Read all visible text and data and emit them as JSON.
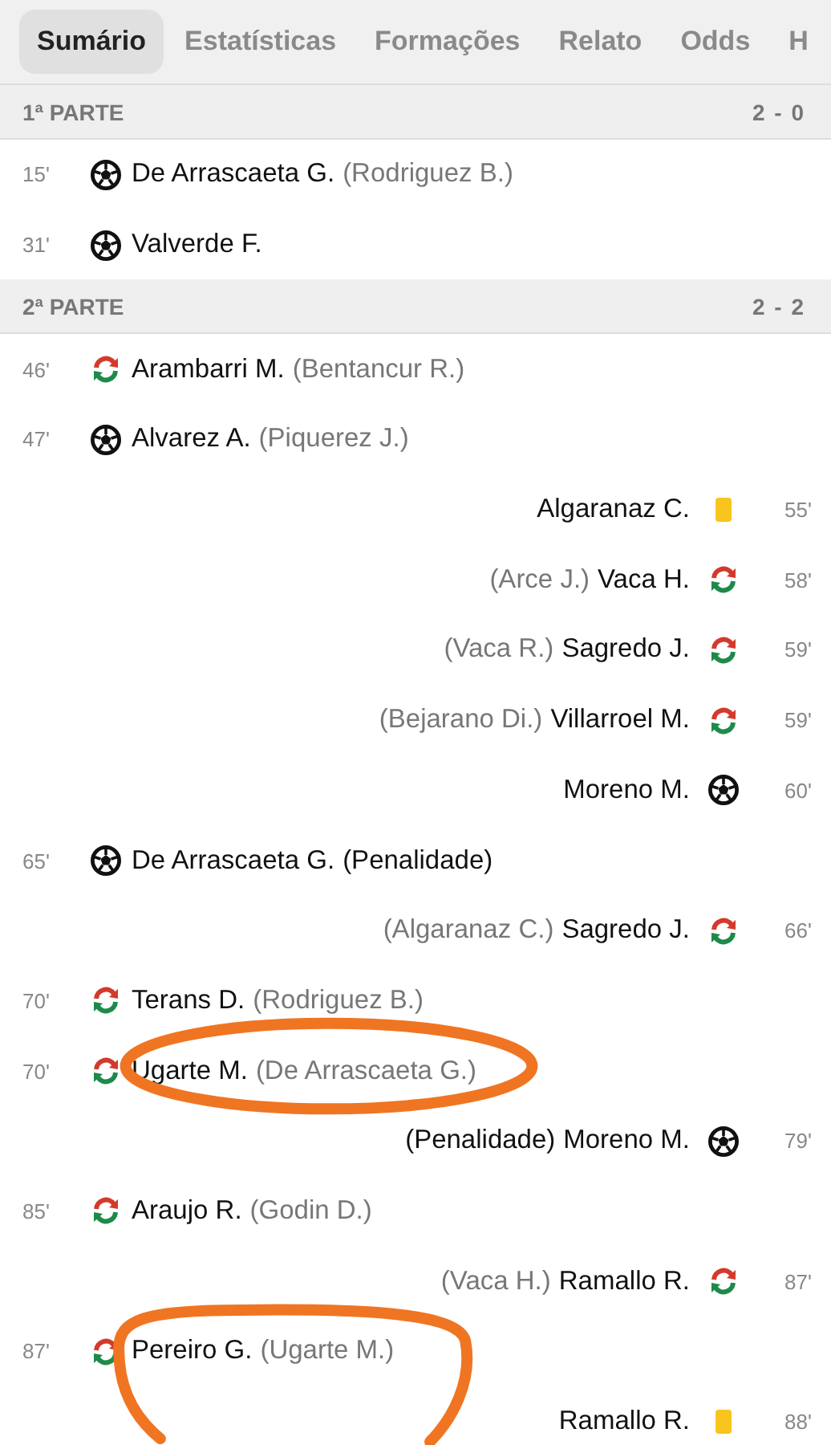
{
  "tabs": [
    {
      "label": "Sumário",
      "selected": true
    },
    {
      "label": "Estatísticas",
      "selected": false
    },
    {
      "label": "Formações",
      "selected": false
    },
    {
      "label": "Relato",
      "selected": false
    },
    {
      "label": "Odds",
      "selected": false
    },
    {
      "label": "H",
      "selected": false
    }
  ],
  "periods": [
    {
      "title": "1ª PARTE",
      "score": "2 - 0",
      "events": [
        {
          "away": false,
          "minute": "15'",
          "kind": "goal",
          "player": "De Arrascaeta G.",
          "assist": "(Rodriguez B.)"
        },
        {
          "away": false,
          "minute": "31'",
          "kind": "goal",
          "player": "Valverde F."
        }
      ]
    },
    {
      "title": "2ª PARTE",
      "score": "2 - 2",
      "events": [
        {
          "away": false,
          "minute": "46'",
          "kind": "sub",
          "player": "Arambarri M.",
          "assist": "(Bentancur R.)"
        },
        {
          "away": false,
          "minute": "47'",
          "kind": "goal",
          "player": "Alvarez A.",
          "assist": "(Piquerez J.)"
        },
        {
          "away": true,
          "minute": "55'",
          "kind": "yellow",
          "player": "Algaranaz C."
        },
        {
          "away": true,
          "minute": "58'",
          "kind": "sub",
          "player": "Vaca H.",
          "assist": "(Arce J.)"
        },
        {
          "away": true,
          "minute": "59'",
          "kind": "sub",
          "player": "Sagredo J.",
          "assist": "(Vaca R.)"
        },
        {
          "away": true,
          "minute": "59'",
          "kind": "sub",
          "player": "Villarroel M.",
          "assist": "(Bejarano Di.)"
        },
        {
          "away": true,
          "minute": "60'",
          "kind": "goal",
          "player": "Moreno M."
        },
        {
          "away": false,
          "minute": "65'",
          "kind": "goal",
          "player": "De Arrascaeta G.",
          "note": "(Penalidade)"
        },
        {
          "away": true,
          "minute": "66'",
          "kind": "sub",
          "player": "Sagredo J.",
          "assist": "(Algaranaz C.)"
        },
        {
          "away": false,
          "minute": "70'",
          "kind": "sub",
          "player": "Terans D.",
          "assist": "(Rodriguez B.)"
        },
        {
          "away": false,
          "minute": "70'",
          "kind": "sub",
          "player": "Ugarte M.",
          "assist": "(De Arrascaeta G.)"
        },
        {
          "away": true,
          "minute": "79'",
          "kind": "goal",
          "player": "Moreno M.",
          "note": "(Penalidade)"
        },
        {
          "away": false,
          "minute": "85'",
          "kind": "sub",
          "player": "Araujo R.",
          "assist": "(Godin D.)"
        },
        {
          "away": true,
          "minute": "87'",
          "kind": "sub",
          "player": "Ramallo R.",
          "assist": "(Vaca H.)"
        },
        {
          "away": false,
          "minute": "87'",
          "kind": "sub",
          "player": "Pereiro G.",
          "assist": "(Ugarte M.)"
        },
        {
          "away": true,
          "minute": "88'",
          "kind": "yellow",
          "player": "Ramallo R."
        }
      ]
    }
  ],
  "annotations": [
    {
      "kind": "ellipse"
    },
    {
      "kind": "open-loop"
    }
  ]
}
